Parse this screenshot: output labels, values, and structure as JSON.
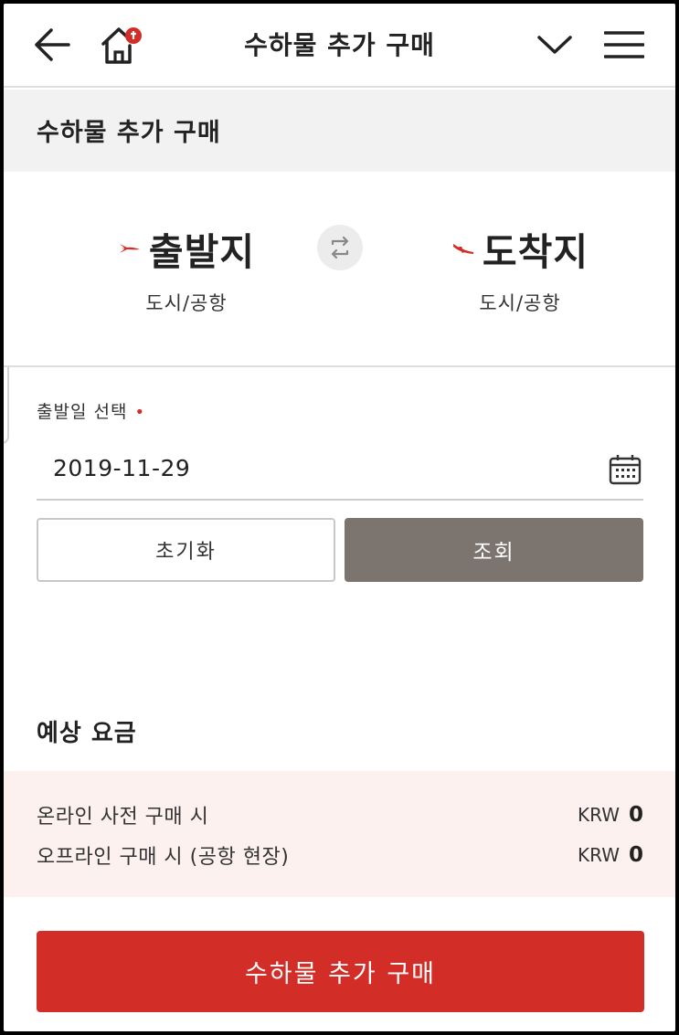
{
  "header": {
    "title": "수하물 추가 구매",
    "back_icon": "arrow-left-icon",
    "home_icon": "home-icon",
    "chevron_icon": "chevron-down-icon",
    "menu_icon": "hamburger-menu-icon",
    "accent_color": "#d22d27"
  },
  "page": {
    "title": "수하물 추가 구매"
  },
  "route": {
    "departure": {
      "label": "출발지",
      "sub": "도시/공항"
    },
    "arrival": {
      "label": "도착지",
      "sub": "도시/공항"
    },
    "swap_icon": "swap-icon"
  },
  "date": {
    "label": "출발일 선택",
    "required_mark": "•",
    "value": "2019-11-29",
    "calendar_icon": "calendar-icon"
  },
  "buttons": {
    "reset": "초기화",
    "search": "조회",
    "buy": "수하물 추가 구매"
  },
  "fees": {
    "title": "예상 요금",
    "rows": [
      {
        "label": "온라인 사전 구매 시",
        "currency": "KRW",
        "amount": "0"
      },
      {
        "label": "오프라인 구매 시 (공항 현장)",
        "currency": "KRW",
        "amount": "0"
      }
    ]
  },
  "colors": {
    "primary": "#d22d27",
    "search_button": "#7b746f",
    "fee_background": "#fdf1f0"
  }
}
